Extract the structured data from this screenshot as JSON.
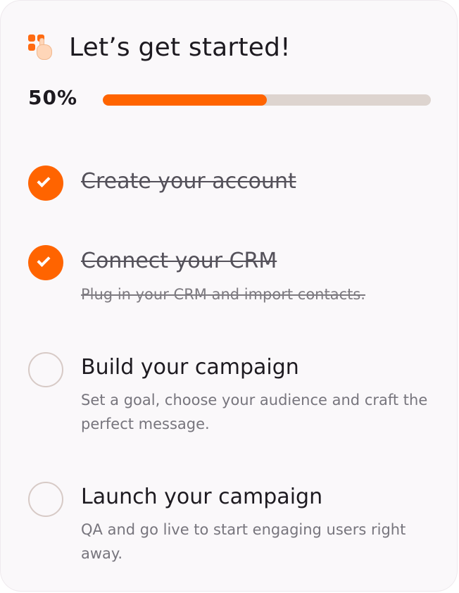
{
  "header": {
    "title": "Let’s get started!",
    "logo_icon": "hand-pointer-icon"
  },
  "progress": {
    "label": "50%",
    "value": 0.5,
    "fill_color": "#ff6400",
    "track_color": "#ddd4cf"
  },
  "steps": [
    {
      "title": "Create your account",
      "description": "",
      "done": true
    },
    {
      "title": "Connect your CRM",
      "description": "Plug in your CRM and import contacts.",
      "done": true
    },
    {
      "title": "Build your campaign",
      "description": "Set a goal, choose your audience and craft the perfect message.",
      "done": false
    },
    {
      "title": "Launch your campaign",
      "description": "QA and go live to start engaging users right away.",
      "done": false
    }
  ]
}
